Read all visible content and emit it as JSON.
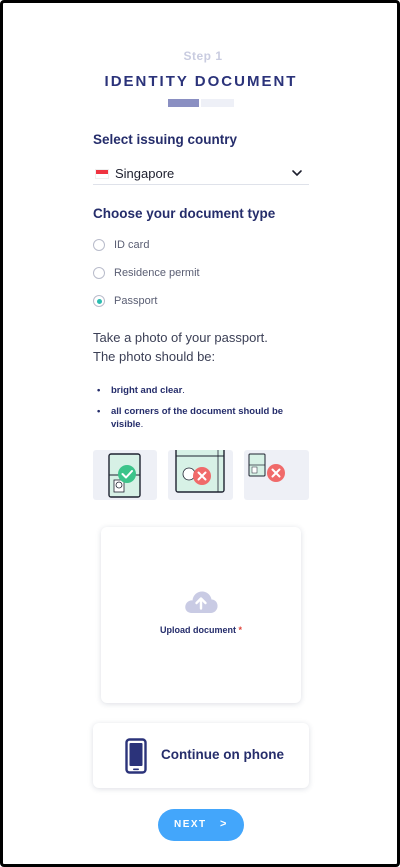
{
  "header": {
    "step": "Step 1",
    "title": "IDENTITY DOCUMENT",
    "progress_fraction": 0.5
  },
  "country": {
    "heading": "Select issuing country",
    "selected": "Singapore",
    "flag": "singapore-flag"
  },
  "doc_type": {
    "heading": "Choose your document type",
    "options": [
      {
        "label": "ID card",
        "checked": false
      },
      {
        "label": "Residence permit",
        "checked": false
      },
      {
        "label": "Passport",
        "checked": true
      }
    ]
  },
  "instructions": {
    "line1": "Take a photo of your passport.",
    "line2": "The photo should be:",
    "bullets": [
      {
        "bold": "bright and clear",
        "suffix": "."
      },
      {
        "bold": "all corners of the document should be visible",
        "suffix": "."
      }
    ]
  },
  "examples": [
    {
      "name": "correct-example",
      "status": "check-icon"
    },
    {
      "name": "cropped-example",
      "status": "x-icon"
    },
    {
      "name": "too-small-example",
      "status": "x-icon"
    }
  ],
  "upload": {
    "label": "Upload document",
    "required_mark": "*",
    "icon": "cloud-upload-icon"
  },
  "phone": {
    "label": "Continue on phone",
    "icon": "phone-icon"
  },
  "next": {
    "label": "NEXT",
    "arrow": ">"
  },
  "colors": {
    "brand": "#2b337a",
    "accent": "#43a6fb",
    "radio_checked": "#2bbcb0",
    "success": "#3cc48a",
    "error": "#f06a6a"
  }
}
